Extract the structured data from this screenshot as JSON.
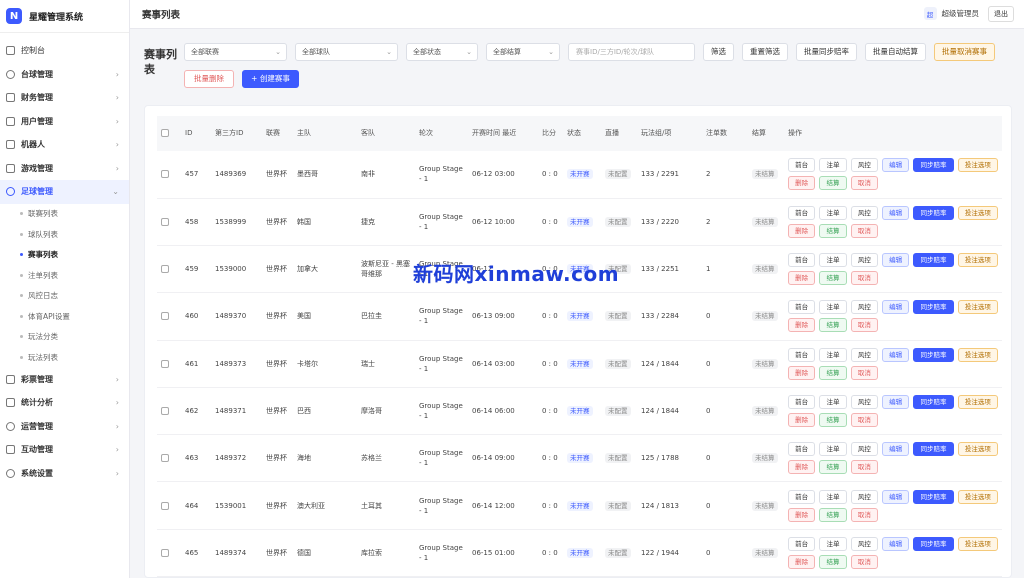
{
  "brand": {
    "logo_letter": "N",
    "name": "星耀管理系统",
    "accent": "#3d5afe"
  },
  "sidebar": {
    "items": [
      {
        "label": "控制台",
        "icon": "grid-icon",
        "arrow": false,
        "plain": true
      },
      {
        "label": "台球管理",
        "icon": "circle-icon",
        "arrow": true
      },
      {
        "label": "财务管理",
        "icon": "dollar-icon",
        "arrow": true
      },
      {
        "label": "用户管理",
        "icon": "users-icon",
        "arrow": true
      },
      {
        "label": "机器人",
        "icon": "robot-icon",
        "arrow": true
      },
      {
        "label": "游戏管理",
        "icon": "gamepad-icon",
        "arrow": true
      },
      {
        "label": "足球管理",
        "icon": "football-icon",
        "arrow": true,
        "open": true
      }
    ],
    "sub_items": [
      {
        "label": "联赛列表"
      },
      {
        "label": "球队列表"
      },
      {
        "label": "赛事列表",
        "active": true
      },
      {
        "label": "注单列表"
      },
      {
        "label": "风控日志"
      },
      {
        "label": "体育API设置"
      },
      {
        "label": "玩法分类"
      },
      {
        "label": "玩法列表"
      }
    ],
    "items_after": [
      {
        "label": "彩票管理",
        "icon": "ticket-icon",
        "arrow": true
      },
      {
        "label": "统计分析",
        "icon": "chart-icon",
        "arrow": true
      },
      {
        "label": "运营管理",
        "icon": "cog-icon",
        "arrow": true
      },
      {
        "label": "互动管理",
        "icon": "chat-icon",
        "arrow": true
      },
      {
        "label": "系统设置",
        "icon": "settings-icon",
        "arrow": true
      }
    ]
  },
  "topbar": {
    "title": "赛事列表",
    "role_badge": "超",
    "user": "超级管理员",
    "logout": "退出"
  },
  "page": {
    "heading": "赛事列表"
  },
  "filters": {
    "league": "全部联赛",
    "team": "全部球队",
    "status": "全部状态",
    "settle": "全部结算",
    "search_placeholder": "赛事ID/三方ID/轮次/球队",
    "btn_filter": "筛选",
    "btn_reset": "重置筛选",
    "btn_batch_sync": "批量同步赔率",
    "btn_batch_auto": "批量自动结算",
    "btn_batch_cancel": "批量取消赛事",
    "btn_batch_delete": "批量删除",
    "btn_create": "+ 创建赛事"
  },
  "table": {
    "headers": [
      "ID",
      "第三方ID",
      "联赛",
      "主队",
      "客队",
      "轮次",
      "开赛时间 最近",
      "比分",
      "状态",
      "直播",
      "玩法组/项",
      "注单数",
      "结算",
      "操作"
    ],
    "ops": {
      "front": "前台",
      "bet": "注单",
      "risk": "风控",
      "edit": "编辑",
      "sync": "同步赔率",
      "opts": "投注选项",
      "del": "删除",
      "settle": "结算",
      "cancel": "取消"
    },
    "rows": [
      {
        "id": "457",
        "tid": "1489369",
        "league": "世界杯",
        "home": "墨西哥",
        "away": "南非",
        "round": "Group Stage - 1",
        "time": "06-12 03:00",
        "score": "0 : 0",
        "status": "未开赛",
        "live": "未配置",
        "plays": "133 / 2291",
        "bets": "2",
        "settle": "未结算"
      },
      {
        "id": "458",
        "tid": "1538999",
        "league": "世界杯",
        "home": "韩国",
        "away": "捷克",
        "round": "Group Stage - 1",
        "time": "06-12 10:00",
        "score": "0 : 0",
        "status": "未开赛",
        "live": "未配置",
        "plays": "133 / 2220",
        "bets": "2",
        "settle": "未结算"
      },
      {
        "id": "459",
        "tid": "1539000",
        "league": "世界杯",
        "home": "加拿大",
        "away": "波斯尼亚 - 黑塞哥维那",
        "round": "Group Stage - 1",
        "time": "06-12 ",
        "score": "0 : 0",
        "status": "未开赛",
        "live": "未配置",
        "plays": "133 / 2251",
        "bets": "1",
        "settle": "未结算"
      },
      {
        "id": "460",
        "tid": "1489370",
        "league": "世界杯",
        "home": "美国",
        "away": "巴拉圭",
        "round": "Group Stage - 1",
        "time": "06-13 09:00",
        "score": "0 : 0",
        "status": "未开赛",
        "live": "未配置",
        "plays": "133 / 2284",
        "bets": "0",
        "settle": "未结算"
      },
      {
        "id": "461",
        "tid": "1489373",
        "league": "世界杯",
        "home": "卡塔尔",
        "away": "瑞士",
        "round": "Group Stage - 1",
        "time": "06-14 03:00",
        "score": "0 : 0",
        "status": "未开赛",
        "live": "未配置",
        "plays": "124 / 1844",
        "bets": "0",
        "settle": "未结算"
      },
      {
        "id": "462",
        "tid": "1489371",
        "league": "世界杯",
        "home": "巴西",
        "away": "摩洛哥",
        "round": "Group Stage - 1",
        "time": "06-14 06:00",
        "score": "0 : 0",
        "status": "未开赛",
        "live": "未配置",
        "plays": "124 / 1844",
        "bets": "0",
        "settle": "未结算"
      },
      {
        "id": "463",
        "tid": "1489372",
        "league": "世界杯",
        "home": "海地",
        "away": "苏格兰",
        "round": "Group Stage - 1",
        "time": "06-14 09:00",
        "score": "0 : 0",
        "status": "未开赛",
        "live": "未配置",
        "plays": "125 / 1788",
        "bets": "0",
        "settle": "未结算"
      },
      {
        "id": "464",
        "tid": "1539001",
        "league": "世界杯",
        "home": "澳大利亚",
        "away": "土耳其",
        "round": "Group Stage - 1",
        "time": "06-14 12:00",
        "score": "0 : 0",
        "status": "未开赛",
        "live": "未配置",
        "plays": "124 / 1813",
        "bets": "0",
        "settle": "未结算"
      },
      {
        "id": "465",
        "tid": "1489374",
        "league": "世界杯",
        "home": "德国",
        "away": "库拉索",
        "round": "Group Stage - 1",
        "time": "06-15 01:00",
        "score": "0 : 0",
        "status": "未开赛",
        "live": "未配置",
        "plays": "122 / 1944",
        "bets": "0",
        "settle": "未结算"
      }
    ]
  },
  "watermark": "新码网xinmaw.com"
}
